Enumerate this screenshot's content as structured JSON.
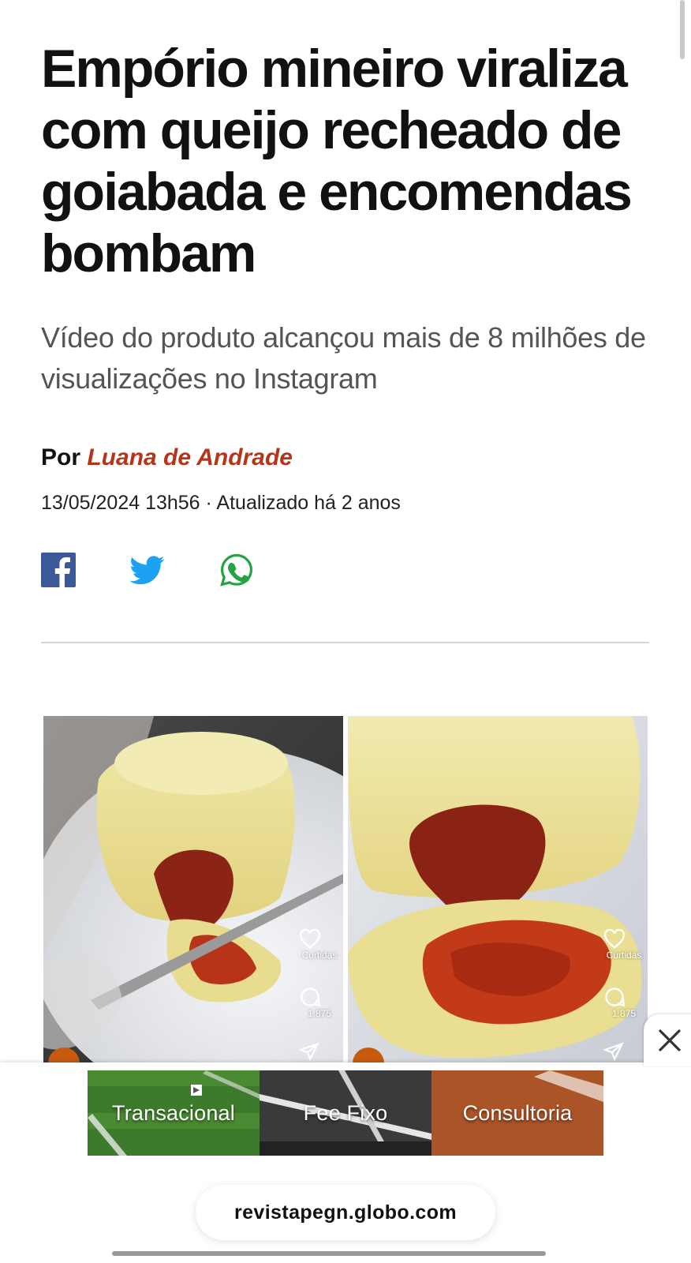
{
  "article": {
    "headline": "Empório mineiro viraliza com queijo recheado de goiabada e encomendas bombam",
    "subtitle": "Vídeo do produto alcançou mais de 8 milhões de visualizações no Instagram",
    "byline_prefix": "Por",
    "author": "Luana de Andrade",
    "dateline": "13/05/2024 13h56 · Atualizado há 2 anos"
  },
  "share": {
    "icons": [
      "facebook-icon",
      "twitter-icon",
      "whatsapp-icon"
    ],
    "colors": {
      "facebook": "#3b5998",
      "twitter": "#1da1f2",
      "whatsapp": "#25a244"
    }
  },
  "media": {
    "frames": [
      {
        "likes_label": "Curtidas",
        "comments_count": "1.875"
      },
      {
        "likes_label": "Curtidas",
        "comments_count": "1.875"
      }
    ]
  },
  "ad": {
    "panels": [
      "Transacional",
      "Fee Fixo",
      "Consultoria"
    ]
  },
  "browser": {
    "url": "revistapegn.globo.com"
  },
  "colors": {
    "author": "#b63518",
    "headline": "#111111",
    "subtitle": "#555555"
  }
}
